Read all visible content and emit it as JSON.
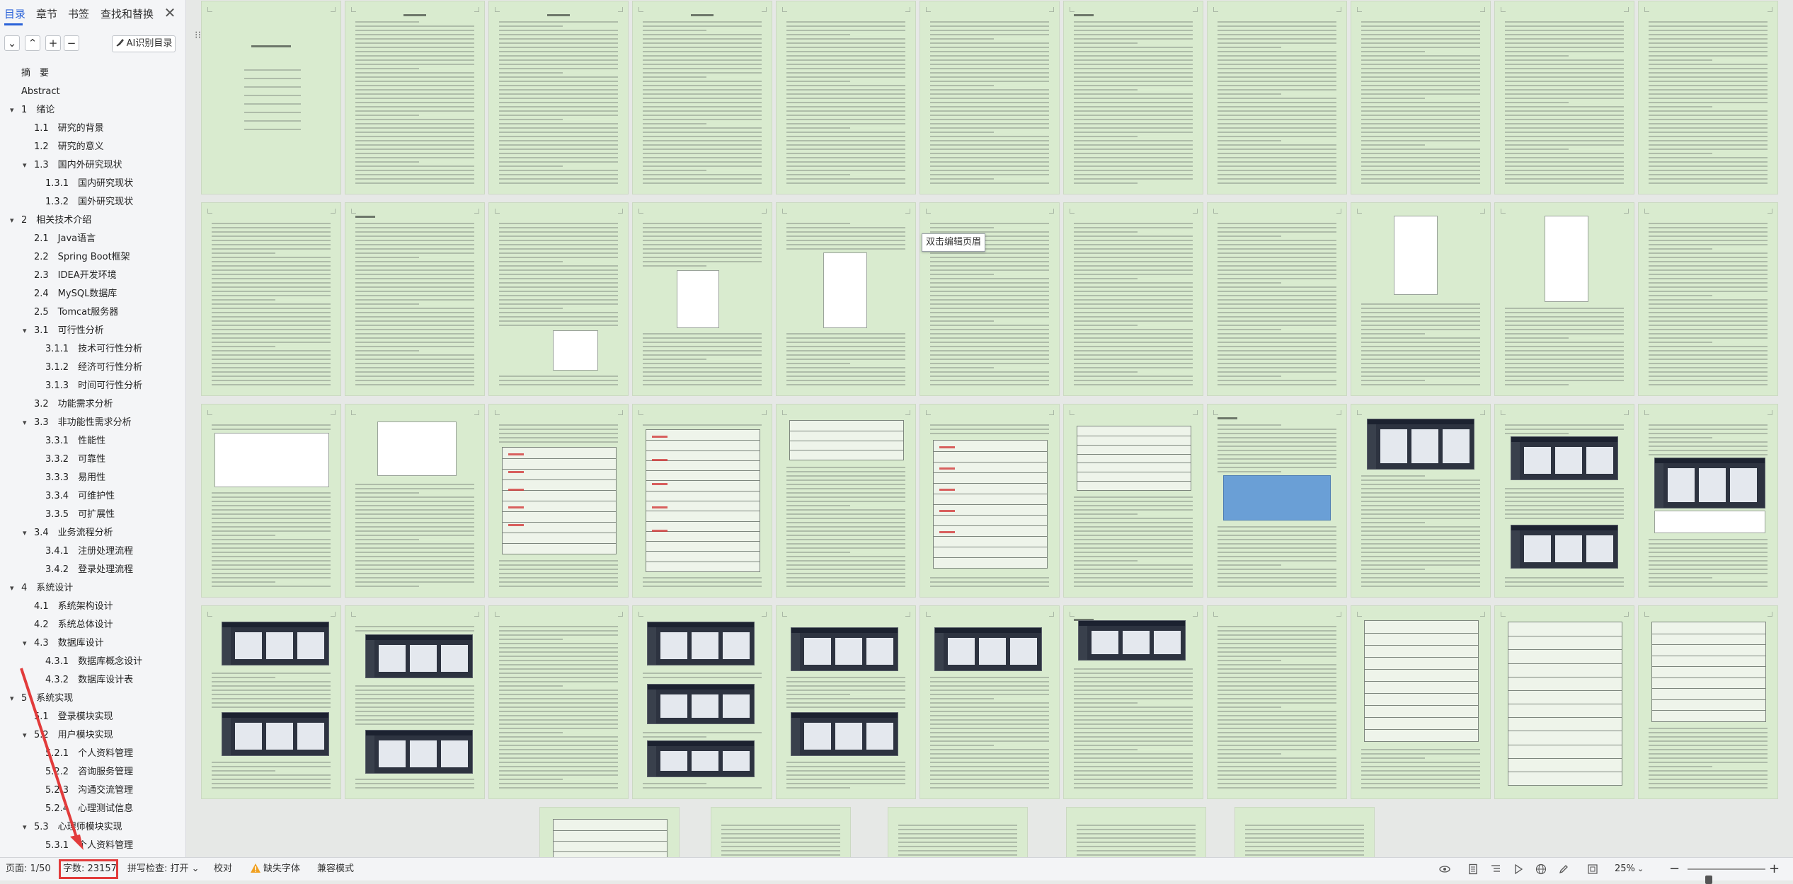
{
  "nav": {
    "tabs": [
      "目录",
      "章节",
      "书签",
      "查找和替换"
    ],
    "active_tab": 0,
    "close_glyph": "✕",
    "tools": {
      "collapse": "⌄",
      "expand": "⌃",
      "add": "+",
      "remove": "−"
    },
    "ai_button": "AI识别目录",
    "ai_icon": "brush-icon",
    "toc": [
      {
        "label": "摘　要",
        "level": 0
      },
      {
        "label": "Abstract",
        "level": 0
      },
      {
        "label": "1　绪论",
        "level": 0,
        "arrow": true
      },
      {
        "label": "1.1　研究的背景",
        "level": 1
      },
      {
        "label": "1.2　研究的意义",
        "level": 1
      },
      {
        "label": "1.3　国内外研究现状",
        "level": 1,
        "arrow": true
      },
      {
        "label": "1.3.1　国内研究现状",
        "level": 2
      },
      {
        "label": "1.3.2　国外研究现状",
        "level": 2
      },
      {
        "label": "2　相关技术介绍",
        "level": 0,
        "arrow": true
      },
      {
        "label": "2.1　Java语言",
        "level": 1
      },
      {
        "label": "2.2　Spring Boot框架",
        "level": 1
      },
      {
        "label": "2.3　IDEA开发环境",
        "level": 1
      },
      {
        "label": "2.4　MySQL数据库",
        "level": 1
      },
      {
        "label": "2.5　Tomcat服务器",
        "level": 1
      },
      {
        "label": "3.1　可行性分析",
        "level": 1,
        "arrow": true
      },
      {
        "label": "3.1.1　技术可行性分析",
        "level": 2
      },
      {
        "label": "3.1.2　经济可行性分析",
        "level": 2
      },
      {
        "label": "3.1.3　时间可行性分析",
        "level": 2
      },
      {
        "label": "3.2　功能需求分析",
        "level": 1
      },
      {
        "label": "3.3　非功能性需求分析",
        "level": 1,
        "arrow": true
      },
      {
        "label": "3.3.1　性能性",
        "level": 2
      },
      {
        "label": "3.3.2　可靠性",
        "level": 2
      },
      {
        "label": "3.3.3　易用性",
        "level": 2
      },
      {
        "label": "3.3.4　可维护性",
        "level": 2
      },
      {
        "label": "3.3.5　可扩展性",
        "level": 2
      },
      {
        "label": "3.4　业务流程分析",
        "level": 1,
        "arrow": true
      },
      {
        "label": "3.4.1　注册处理流程",
        "level": 2
      },
      {
        "label": "3.4.2　登录处理流程",
        "level": 2
      },
      {
        "label": "4　系统设计",
        "level": 0,
        "arrow": true
      },
      {
        "label": "4.1　系统架构设计",
        "level": 1
      },
      {
        "label": "4.2　系统总体设计",
        "level": 1
      },
      {
        "label": "4.3　数据库设计",
        "level": 1,
        "arrow": true
      },
      {
        "label": "4.3.1　数据库概念设计",
        "level": 2
      },
      {
        "label": "4.3.2　数据库设计表",
        "level": 2
      },
      {
        "label": "5　系统实现",
        "level": 0,
        "arrow": true
      },
      {
        "label": "5.1　登录模块实现",
        "level": 1
      },
      {
        "label": "5.2　用户模块实现",
        "level": 1,
        "arrow": true
      },
      {
        "label": "5.2.1　个人资料管理",
        "level": 2
      },
      {
        "label": "5.2.2　咨询服务管理",
        "level": 2
      },
      {
        "label": "5.2.3　沟通交流管理",
        "level": 2
      },
      {
        "label": "5.2.4　心理测试信息",
        "level": 2
      },
      {
        "label": "5.3　心理师模块实现",
        "level": 1,
        "arrow": true
      },
      {
        "label": "5.3.1　个人资料管理",
        "level": 2
      }
    ]
  },
  "document": {
    "tooltip": "双击编辑页眉",
    "corner_toggle": "⁝⁝"
  },
  "statusbar": {
    "page": "页面: 1/50",
    "wordcount": "字数: 23157",
    "spellcheck": "拼写检查: 打开",
    "spellcheck_caret": "⌄",
    "proofread": "校对",
    "warning_icon": "warning-icon",
    "missing_font": "缺失字体",
    "compat_mode": "兼容模式",
    "zoom": "25%",
    "zoom_minus": "−",
    "zoom_plus": "+",
    "zoom_level": 0.25,
    "icons": [
      "eye-icon",
      "page-view-icon",
      "outline-icon",
      "play-icon",
      "globe-icon",
      "pen-icon",
      "fit-page-icon"
    ],
    "accent_red": "#e23b3b"
  },
  "colors": {
    "accent": "#2a62d8",
    "page_background": "#d9ebcf",
    "annotation": "#e23b3b"
  }
}
